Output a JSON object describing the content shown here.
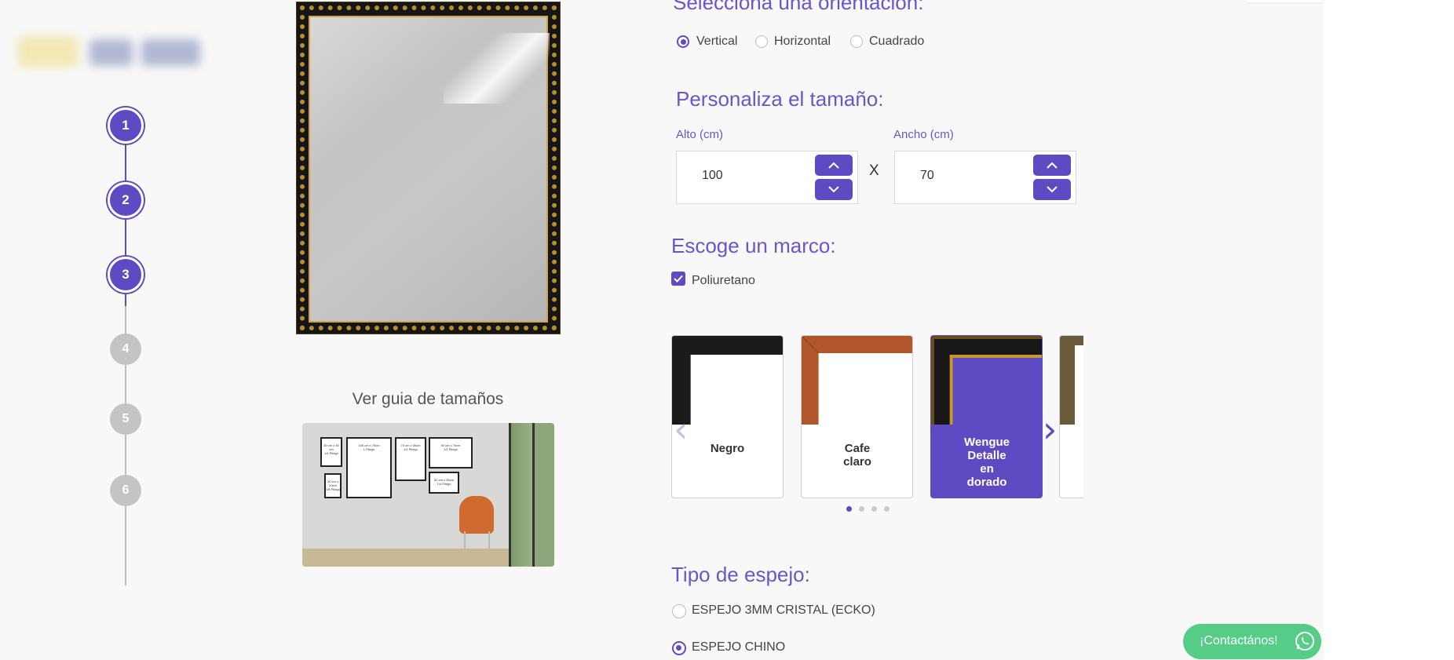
{
  "orientation": {
    "heading": "Selecciona una orientación:",
    "options": [
      "Vertical",
      "Horizontal",
      "Cuadrado"
    ],
    "selected": "Vertical"
  },
  "stepper": {
    "steps": [
      "1",
      "2",
      "3",
      "4",
      "5",
      "6"
    ],
    "completed_through": 3,
    "accent": "#5e4bc4",
    "inactive_color": "#c4c4c4"
  },
  "preview": {
    "guide_label": "Ver guia de tamaños",
    "guide_frames": [
      {
        "size": "30 cm x 30 cm",
        "pliego": "1/4 Pliego"
      },
      {
        "size": "100 cm x 70cm",
        "pliego": "1 Pliego"
      },
      {
        "size": "70 cm x 50cm",
        "pliego": "1/2 Pliego"
      },
      {
        "size": "50 cm x 70cm",
        "pliego": "1/2 Pliego"
      },
      {
        "size": "50 cm x 35cm",
        "pliego": "1/4 Pliego"
      },
      {
        "size": "30 cm x 20cm",
        "pliego": "1/8 Pliego"
      }
    ]
  },
  "size": {
    "heading": "Personaliza el tamaño:",
    "alto_label": "Alto (cm)",
    "alto_value": "100",
    "ancho_label": "Ancho (cm)",
    "ancho_value": "70",
    "separator": "X"
  },
  "frame": {
    "heading": "Escoge un marco:",
    "material_label": "Poliuretano",
    "material_checked": true,
    "options": [
      {
        "name": "Negro",
        "color": "#1b1b1b"
      },
      {
        "name": "Cafe claro",
        "color": "#b0562a"
      },
      {
        "name": "Wengue Detalle en dorado",
        "color": "#171717",
        "selected": true
      },
      {
        "name": "",
        "color": "#6b5a3a"
      }
    ],
    "page_count": 4,
    "current_page": 1
  },
  "mirror": {
    "heading": "Tipo de espejo:",
    "options": [
      "ESPEJO 3MM CRISTAL (ECKO)",
      "ESPEJO CHINO"
    ],
    "selected": "ESPEJO CHINO"
  },
  "contact": {
    "label": "¡Contactános!",
    "color": "#55cc87"
  }
}
